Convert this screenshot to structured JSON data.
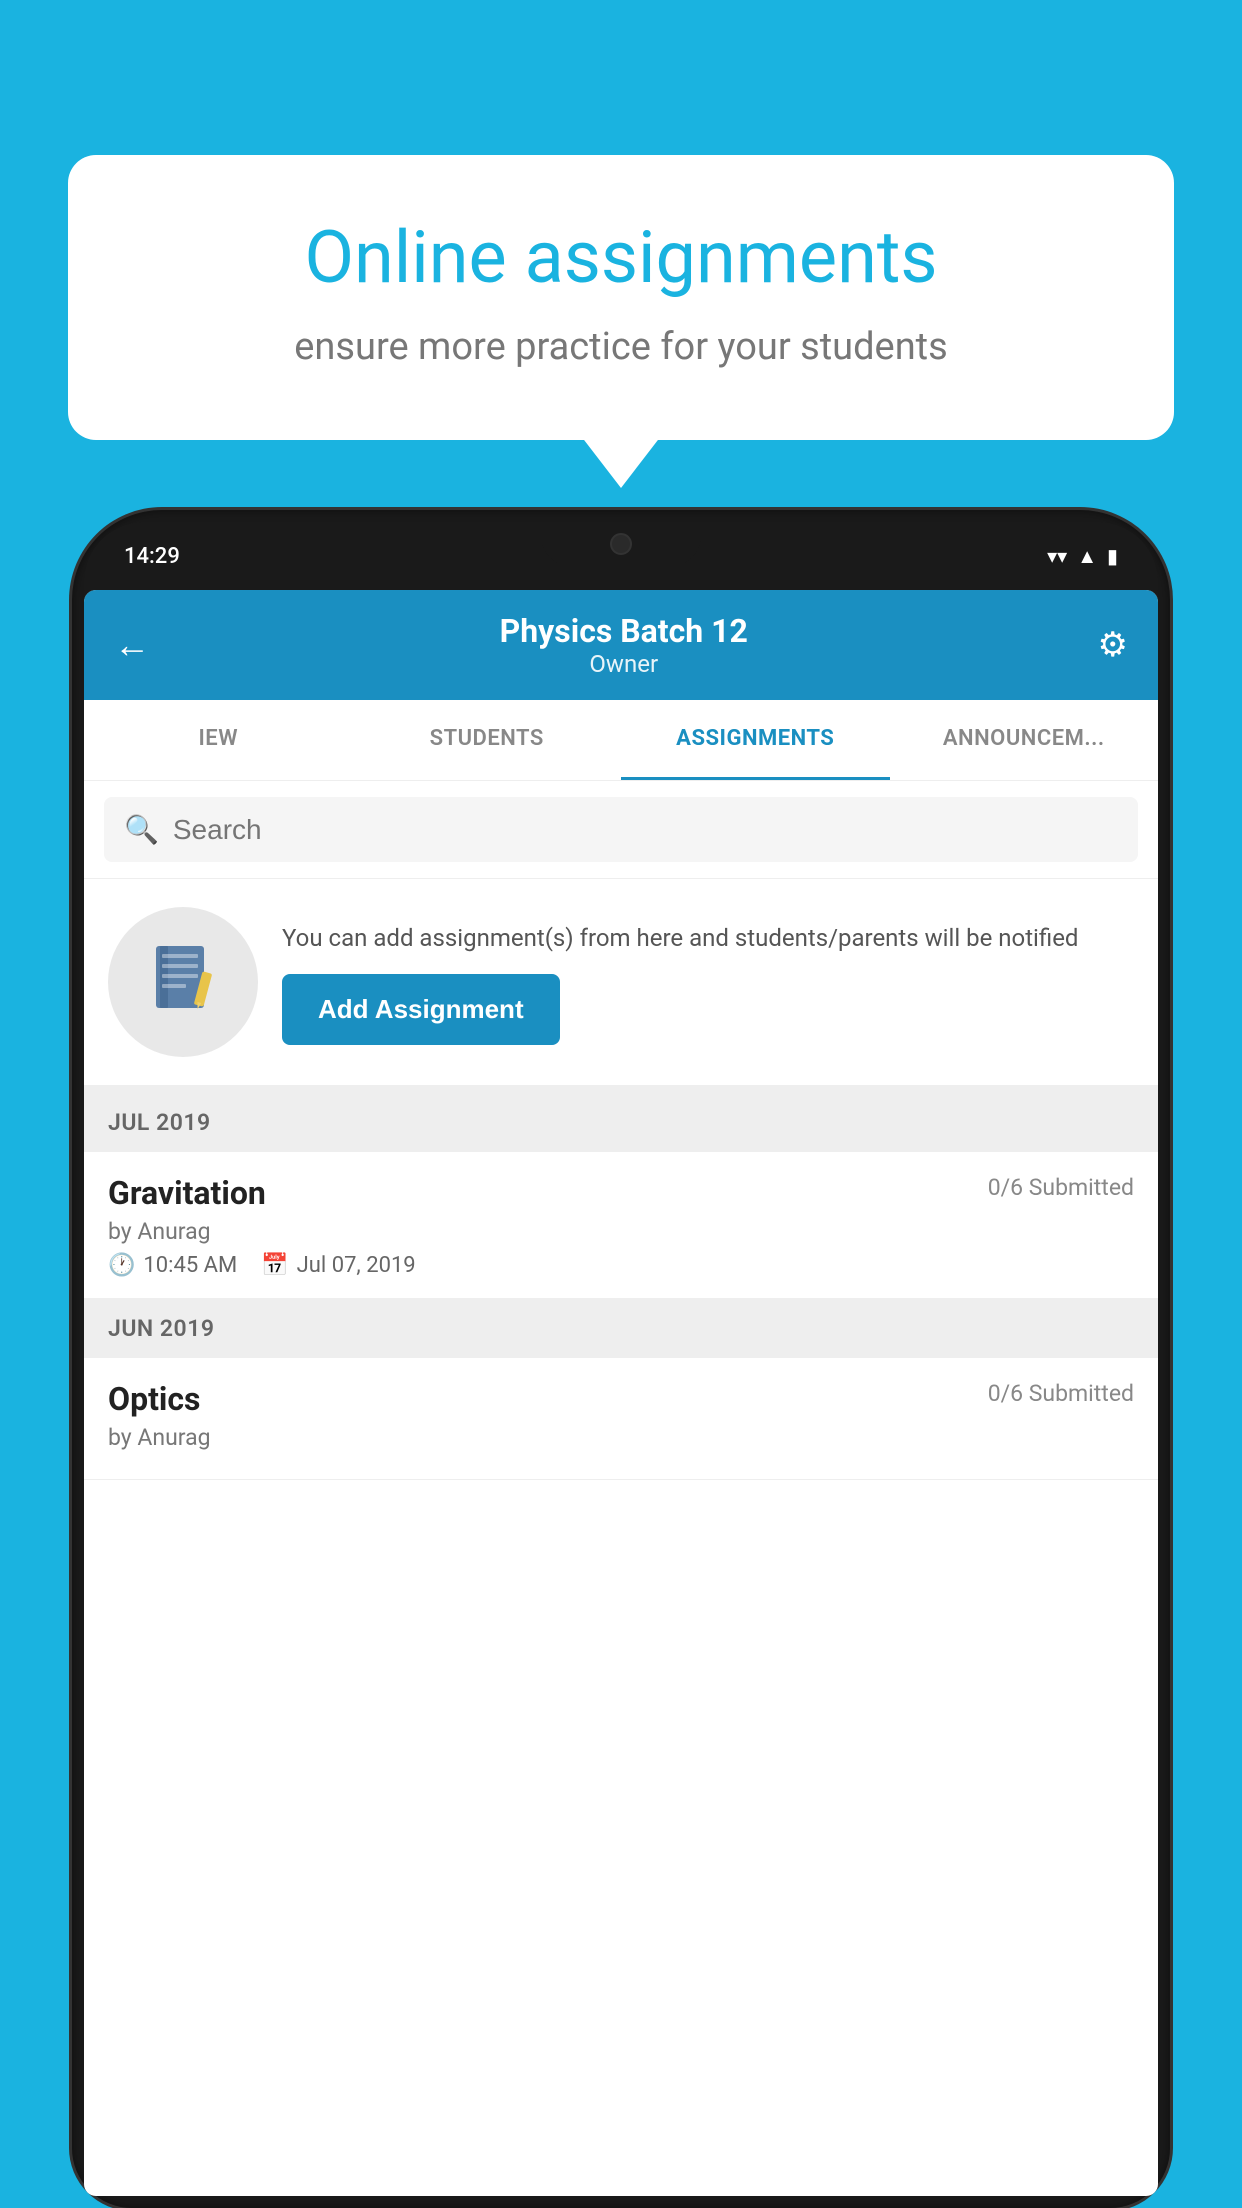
{
  "background_color": "#1ab3e0",
  "speech_bubble": {
    "title": "Online assignments",
    "subtitle": "ensure more practice for your students"
  },
  "phone": {
    "status_bar": {
      "time": "14:29"
    },
    "app_bar": {
      "title": "Physics Batch 12",
      "subtitle": "Owner",
      "back_icon": "←",
      "settings_icon": "⚙"
    },
    "tabs": [
      {
        "label": "IEW",
        "active": false
      },
      {
        "label": "STUDENTS",
        "active": false
      },
      {
        "label": "ASSIGNMENTS",
        "active": true
      },
      {
        "label": "ANNOUNCEM...",
        "active": false
      }
    ],
    "search": {
      "placeholder": "Search"
    },
    "info_box": {
      "text": "You can add assignment(s) from here and students/parents will be notified",
      "button_label": "Add Assignment"
    },
    "sections": [
      {
        "month_label": "JUL 2019",
        "assignments": [
          {
            "title": "Gravitation",
            "submitted": "0/6 Submitted",
            "author": "by Anurag",
            "time": "10:45 AM",
            "date": "Jul 07, 2019"
          }
        ]
      },
      {
        "month_label": "JUN 2019",
        "assignments": [
          {
            "title": "Optics",
            "submitted": "0/6 Submitted",
            "author": "by Anurag",
            "time": "",
            "date": ""
          }
        ]
      }
    ]
  }
}
